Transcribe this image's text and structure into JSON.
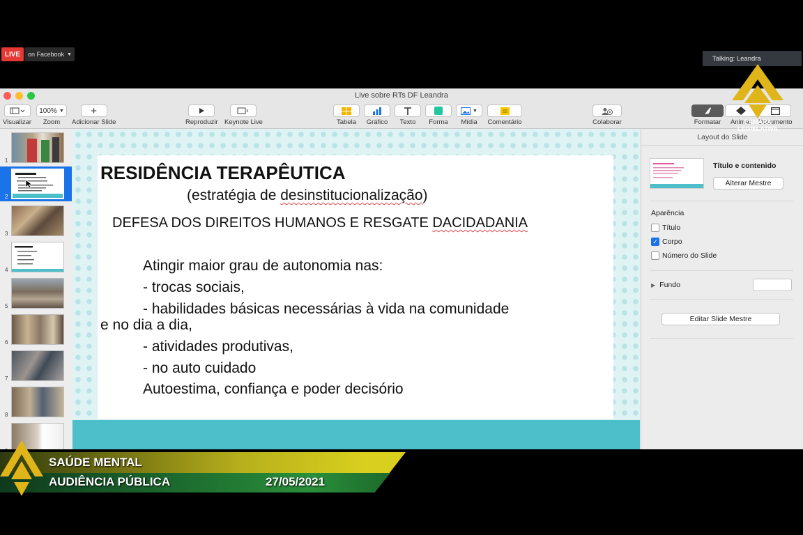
{
  "stream": {
    "live_label": "LIVE",
    "platform_label": "on Facebook",
    "talking": "Talking: Leandra"
  },
  "window": {
    "title": "Live sobre RTs DF Leandra"
  },
  "toolbar": {
    "visualizar": "Visualizar",
    "zoom": "Zoom",
    "zoom_value": "100%",
    "adicionar_slide": "Adicionar Slide",
    "reproduzir": "Reproduzir",
    "keynote_live": "Keynote Live",
    "tabela": "Tabela",
    "grafico": "Gráfico",
    "texto": "Texto",
    "forma": "Forma",
    "midia": "Mídia",
    "comentario": "Comentário",
    "colaborar": "Colaborar",
    "formatar": "Formatar",
    "animar": "Animar",
    "documento": "Documento"
  },
  "navigator": {
    "slides": [
      "1",
      "2",
      "3",
      "4",
      "5",
      "6",
      "7",
      "8",
      "9"
    ],
    "selected": "2"
  },
  "slide": {
    "title": "RESIDÊNCIA TERAPÊUTICA",
    "subtitle_open": "(estratégia de ",
    "subtitle_word": "desinstitucionalização",
    "subtitle_close": ")",
    "heading_lead": "DEFESA DOS DIREITOS HUMANOS E RESGATE ",
    "heading_word": "DACIDADANIA",
    "lines": [
      "Atingir maior grau de autonomia nas:",
      "- trocas sociais,",
      "- habilidades básicas necessárias à vida na comunidade",
      "e no dia a dia,",
      "- atividades produtivas,",
      "- no auto cuidado",
      "Autoestima, confiança e poder decisório"
    ]
  },
  "inspector": {
    "header": "Layout do Slide",
    "layout_name": "Título e contenido",
    "change_master": "Alterar Mestre",
    "appearance": "Aparência",
    "title_cb": "Título",
    "body_cb": "Corpo",
    "slide_number_cb": "Número do Slide",
    "background": "Fundo",
    "edit_master": "Editar Slide Mestre"
  },
  "broadcast": {
    "logo_line1": "CÂMARA",
    "logo_line2": "LEGISLATIVA",
    "line1": "SAÚDE MENTAL",
    "line2": "AUDIÊNCIA PÚBLICA",
    "date": "27/05/2021"
  },
  "colors": {
    "live_red": "#e53935",
    "selection_blue": "#1a73e8",
    "slide_band": "#4dbfca",
    "lower_third_gold": "#d8cf1e",
    "lower_third_green": "#1c6a2e"
  }
}
